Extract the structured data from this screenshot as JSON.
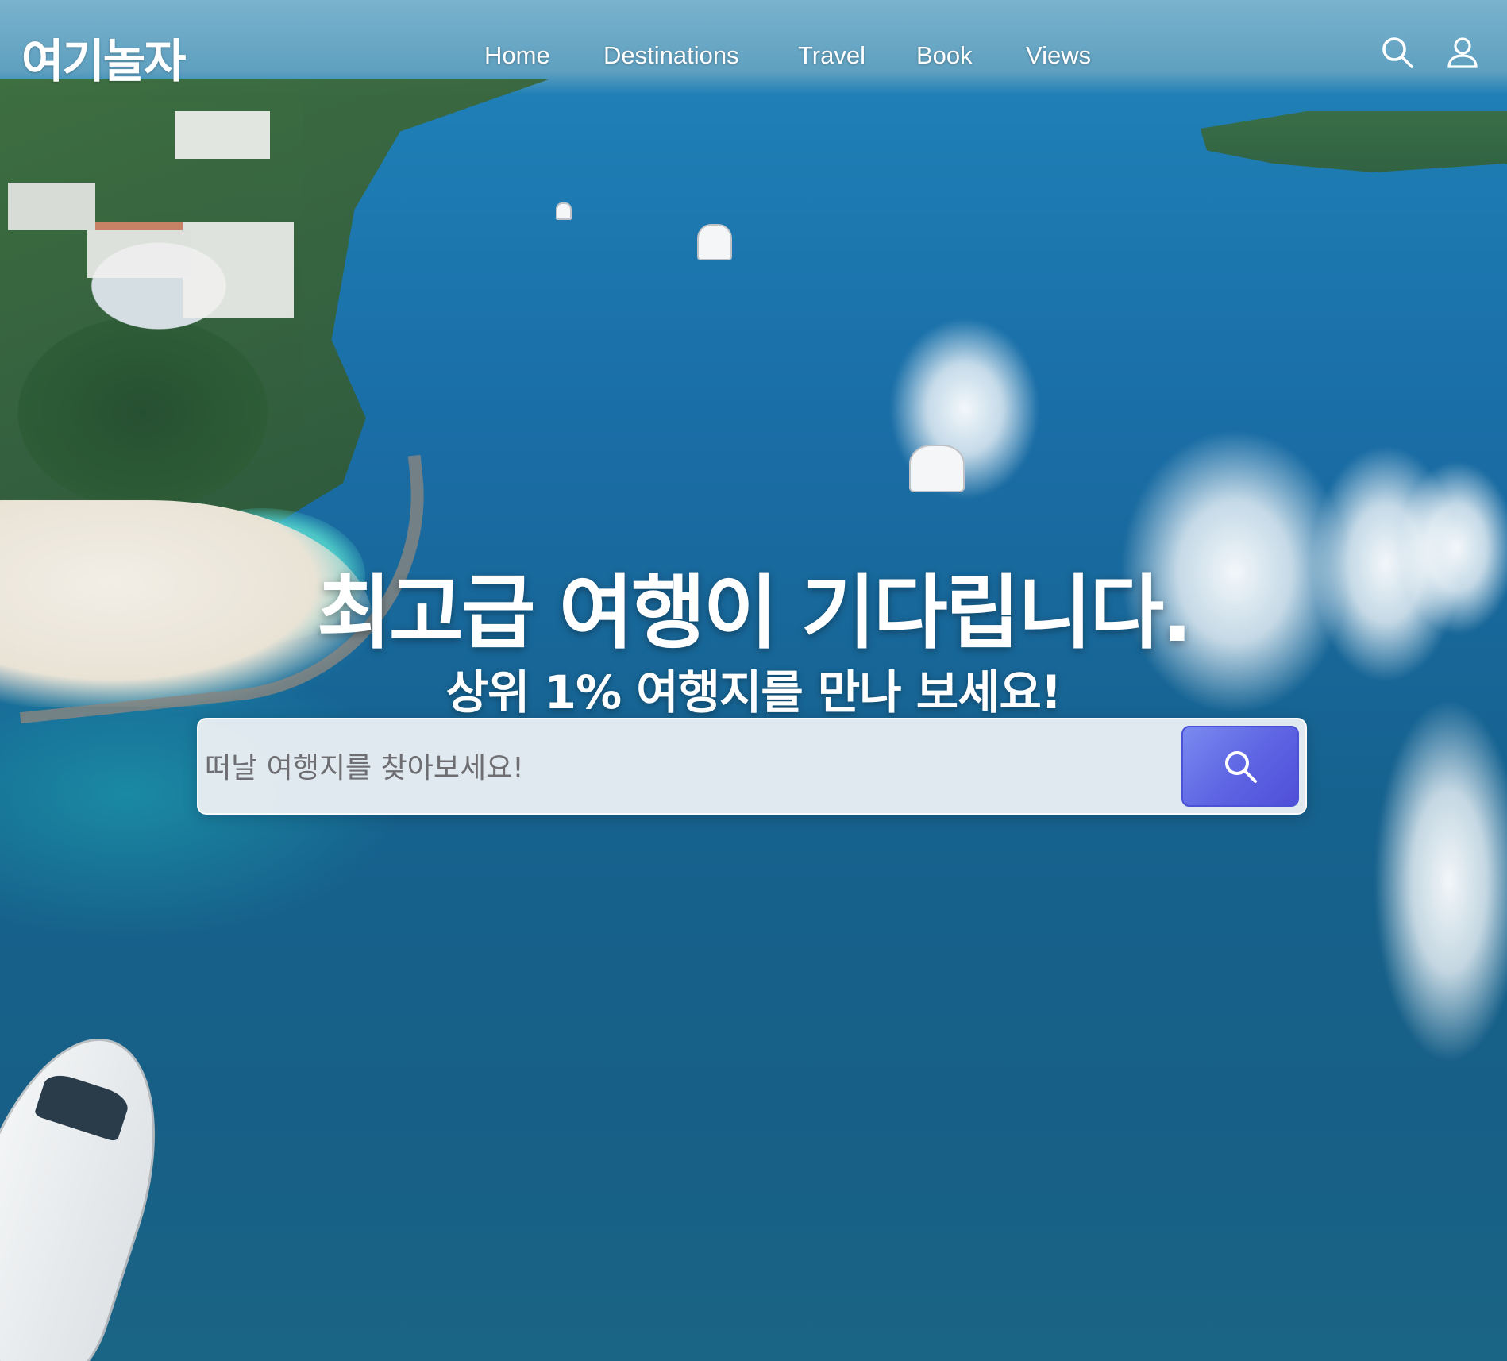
{
  "header": {
    "logo": "여기놀자",
    "nav": [
      {
        "label": "Home"
      },
      {
        "label": "Destinations"
      },
      {
        "label": "Travel"
      },
      {
        "label": "Book"
      },
      {
        "label": "Views"
      }
    ],
    "icons": {
      "search": "search-icon",
      "user": "user-icon"
    }
  },
  "hero": {
    "title": "최고급 여행이 기다립니다.",
    "subtitle": "상위 1% 여행지를 만나 보세요!",
    "search": {
      "placeholder": "떠날 여행지를 찾아보세요!",
      "value": "",
      "button_icon": "search-icon"
    }
  },
  "colors": {
    "accent": "#5d63e2",
    "text": "#ffffff"
  }
}
